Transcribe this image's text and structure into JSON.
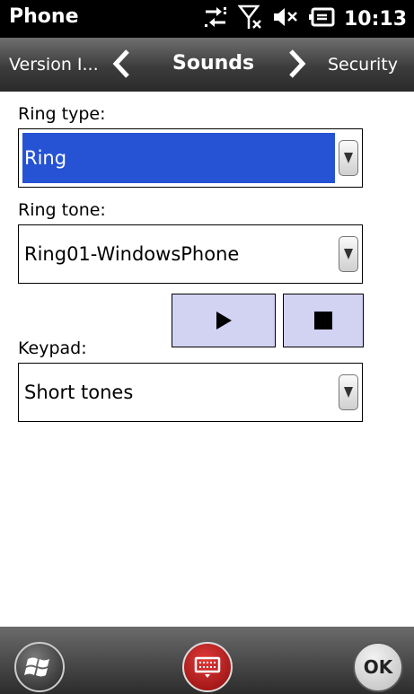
{
  "status": {
    "app_title": "Phone",
    "time": "10:13"
  },
  "nav": {
    "prev_label": "Version I...",
    "current_label": "Sounds",
    "next_label": "Security"
  },
  "ring_type": {
    "label": "Ring type:",
    "value": "Ring"
  },
  "ring_tone": {
    "label": "Ring tone:",
    "value": "Ring01-WindowsPhone"
  },
  "keypad": {
    "label": "Keypad:",
    "value": "Short tones"
  },
  "bottom": {
    "ok_label": "OK"
  },
  "colors": {
    "selection": "#2653d4",
    "button_fill": "#d2d2f2"
  }
}
